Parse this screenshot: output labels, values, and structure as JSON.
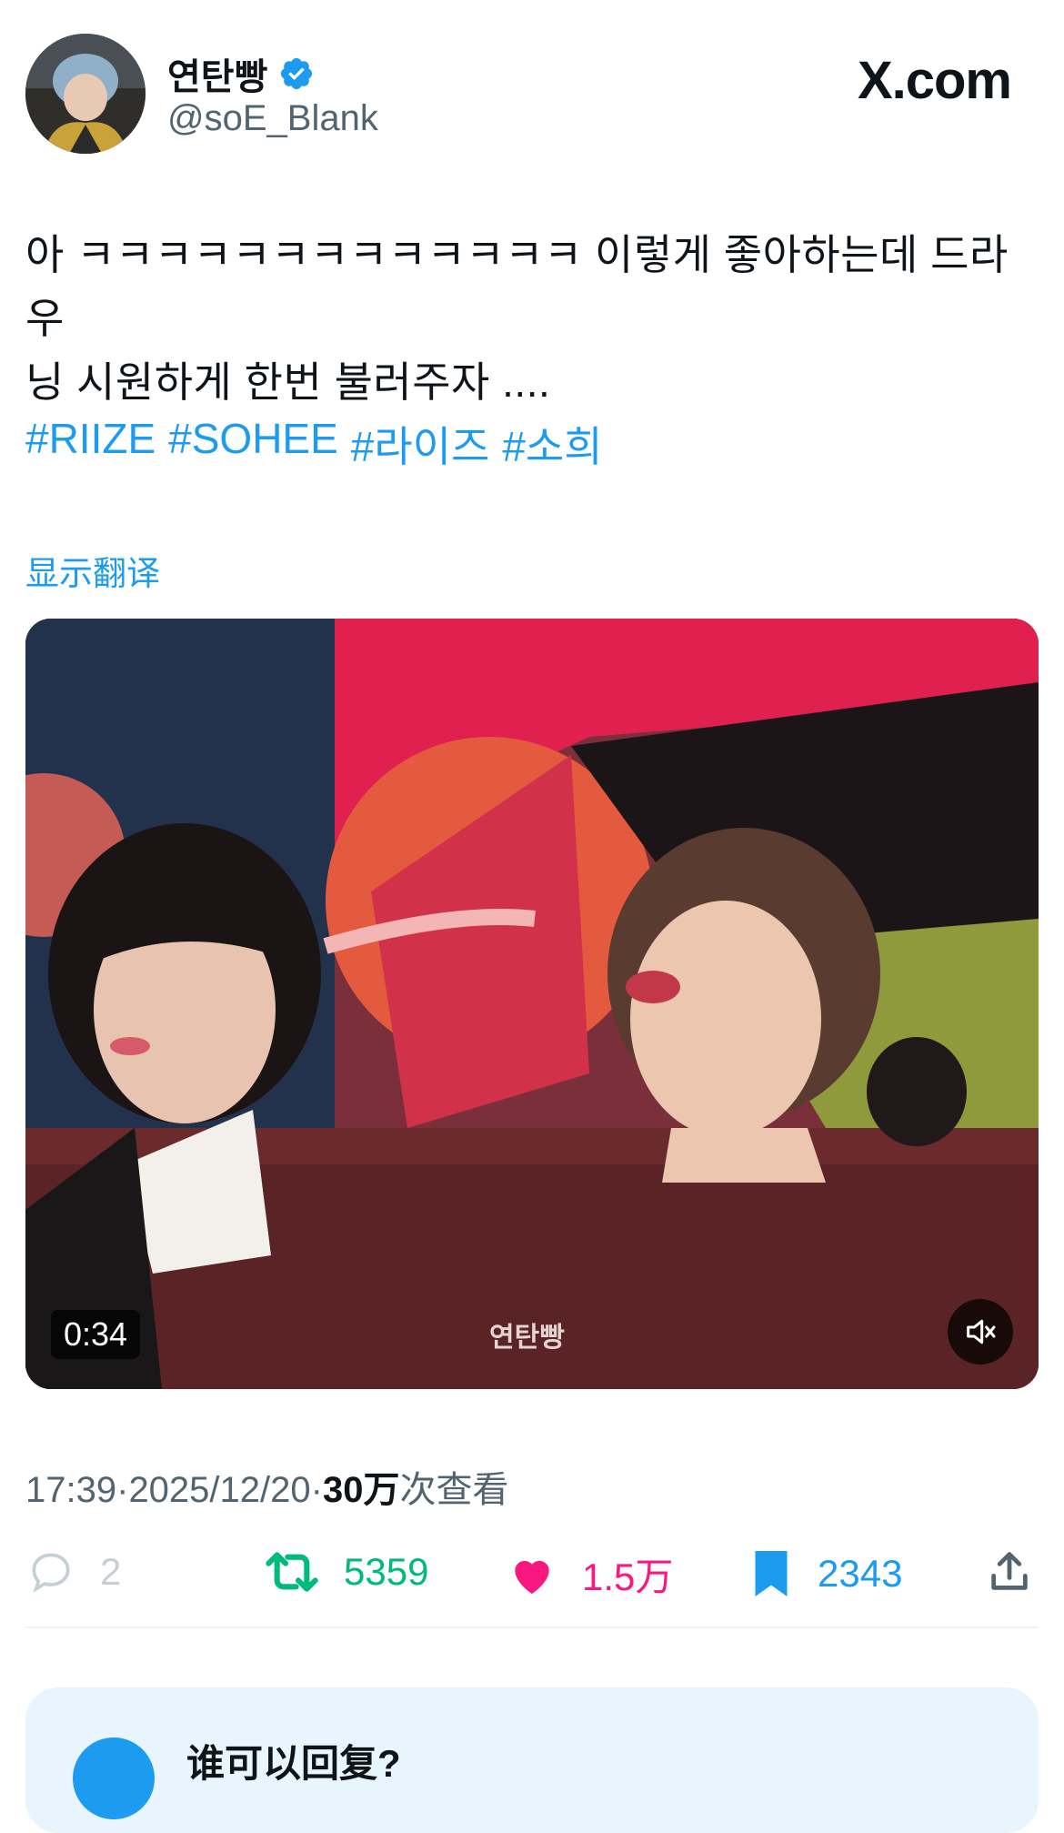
{
  "author": {
    "display_name": "연탄빵",
    "handle": "@soE_Blank",
    "verified": true,
    "avatar_icon": "user-avatar"
  },
  "brand": "X.com",
  "tweet": {
    "text_line1": "아 ㅋㅋㅋㅋㅋㅋㅋㅋㅋㅋㅋㅋㅋ 이렇게 좋아하는데 드라우",
    "text_line2": "닝 시원하게 한번 불러주자 ....",
    "hashtags": [
      "#RIIZE",
      "#SOHEE",
      "#라이즈",
      "#소희"
    ],
    "translate_label": "显示翻译"
  },
  "media": {
    "duration": "0:34",
    "watermark": "연탄빵",
    "mute_icon": "speaker-muted-icon"
  },
  "meta": {
    "time": "17:39",
    "sep": " · ",
    "date": "2025/12/20",
    "views_count": "30万",
    "views_label": " 次查看"
  },
  "actions": {
    "reply_count": "2",
    "retweet_count": "5359",
    "like_count": "1.5万",
    "bookmark_count": "2343"
  },
  "reply_card": {
    "title": "谁可以回复?"
  },
  "colors": {
    "accent": "#1d9bf0",
    "retweet": "#00ba7c",
    "like": "#f91880",
    "muted": "#536471"
  }
}
